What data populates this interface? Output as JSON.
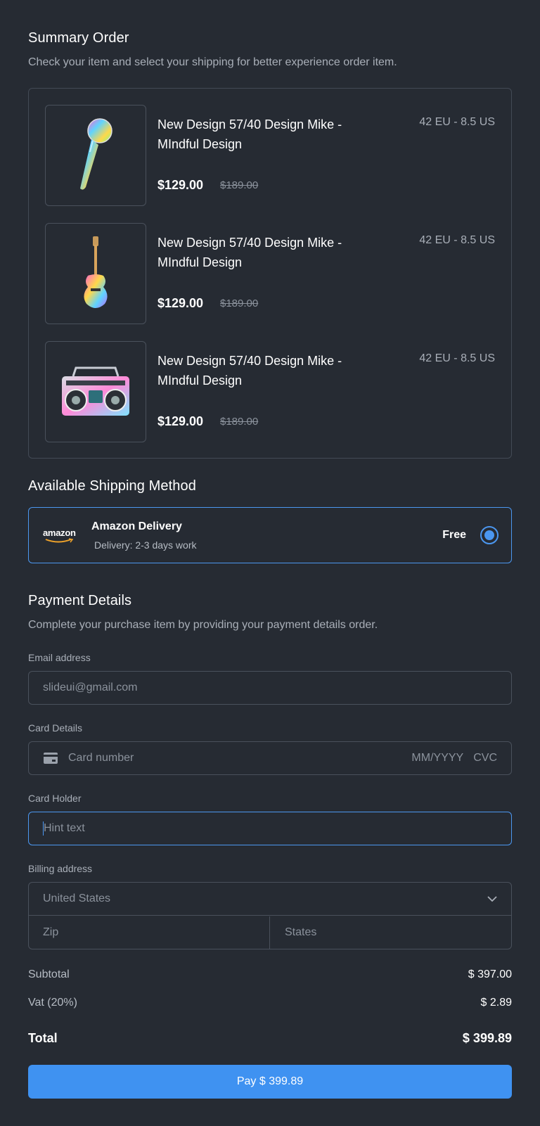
{
  "summary": {
    "title": "Summary Order",
    "subtitle": "Check your item and select your shipping for better experience order item."
  },
  "items": [
    {
      "name": "New Design 57/40 Design Mike - MIndful Design",
      "size": "42 EU - 8.5 US",
      "price": "$129.00",
      "old_price": "$189.00",
      "icon": "microphone-image"
    },
    {
      "name": "New Design 57/40 Design Mike - MIndful Design",
      "size": "42 EU - 8.5 US",
      "price": "$129.00",
      "old_price": "$189.00",
      "icon": "guitar-image"
    },
    {
      "name": "New Design 57/40 Design Mike - MIndful Design",
      "size": "42 EU - 8.5 US",
      "price": "$129.00",
      "old_price": "$189.00",
      "icon": "boombox-image"
    }
  ],
  "shipping": {
    "title": "Available Shipping Method",
    "logo_text": "amazon",
    "method_name": "Amazon Delivery",
    "method_detail": "Delivery: 2-3 days work",
    "price": "Free",
    "selected": true
  },
  "payment": {
    "title": "Payment Details",
    "subtitle": "Complete your purchase item by providing your payment details order.",
    "email_label": "Email address",
    "email_placeholder": "slideui@gmail.com",
    "card_label": "Card Details",
    "card_placeholder": "Card number",
    "card_expiry_placeholder": "MM/YYYY",
    "card_cvc_placeholder": "CVC",
    "holder_label": "Card Holder",
    "holder_placeholder": "Hint text",
    "billing_label": "Billing address",
    "country_value": "United States",
    "zip_placeholder": "Zip",
    "state_placeholder": "States"
  },
  "totals": {
    "subtotal_label": "Subtotal",
    "subtotal_value": "$ 397.00",
    "vat_label": "Vat (20%)",
    "vat_value": "$ 2.89",
    "total_label": "Total",
    "total_value": "$ 399.89"
  },
  "pay_button": "Pay $ 399.89",
  "colors": {
    "background": "#262b33",
    "accent": "#3f92f1",
    "border": "#4a515c"
  }
}
